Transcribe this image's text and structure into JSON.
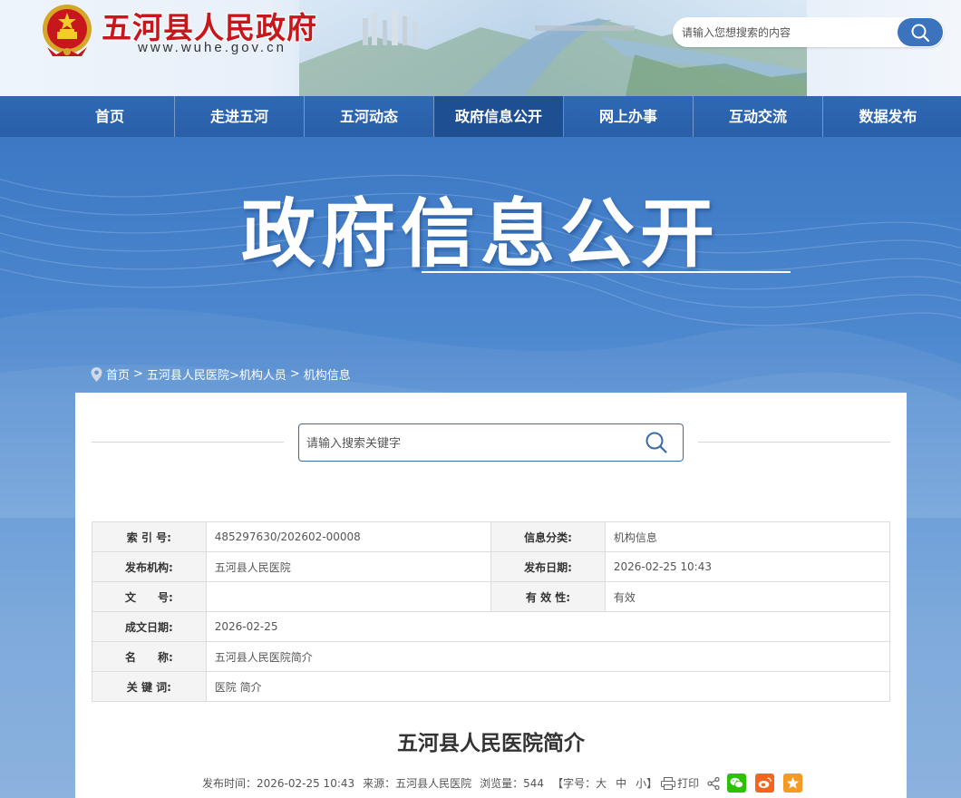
{
  "header": {
    "site_title": "五河县人民政府",
    "site_domain": "www.wuhe.gov.cn",
    "search_placeholder": "请输入您想搜索的内容"
  },
  "nav": {
    "items": [
      {
        "label": "首页",
        "active": false
      },
      {
        "label": "走进五河",
        "active": false
      },
      {
        "label": "五河动态",
        "active": false
      },
      {
        "label": "政府信息公开",
        "active": true
      },
      {
        "label": "网上办事",
        "active": false
      },
      {
        "label": "互动交流",
        "active": false
      },
      {
        "label": "数据发布",
        "active": false
      }
    ]
  },
  "banner": {
    "title": "政府信息公开"
  },
  "breadcrumb": {
    "home": "首页",
    "sep": ">",
    "crumb1": "五河县人民医院",
    "crumb2": ">机构人员",
    "crumb3": "机构信息"
  },
  "panel_search": {
    "placeholder": "请输入搜索关键字"
  },
  "info_table": {
    "index_label": "索 引 号:",
    "index_value": "485297630/202602-00008",
    "category_label": "信息分类:",
    "category_value": "机构信息",
    "publisher_label": "发布机构:",
    "publisher_value": "五河县人民医院",
    "publish_date_label": "发布日期:",
    "publish_date_value": "2026-02-25 10:43",
    "docno_label": "文　　号:",
    "docno_value": "",
    "validity_label": "有 效 性:",
    "validity_value": "有效",
    "created_label": "成文日期:",
    "created_value": "2026-02-25",
    "name_label": "名　　称:",
    "name_value": "五河县人民医院简介",
    "keywords_label": "关 键 词:",
    "keywords_value": "医院 简介"
  },
  "article": {
    "title": "五河县人民医院简介",
    "publish_time": "发布时间：2026-02-25 10:43",
    "source": "来源：五河县人民医院",
    "views": "浏览量：544",
    "font_size_prefix": "【字号：",
    "font_large": "大",
    "font_medium": "中",
    "font_small": "小",
    "font_size_suffix": "】",
    "print": "打印"
  },
  "colors": {
    "brand_red": "#c8161d",
    "nav_blue": "#2a5fa8",
    "nav_active": "#1f4f93",
    "wechat_green": "#2dc100",
    "weibo_orange": "#f4651f",
    "favorite_orange": "#f59a23"
  },
  "icons": [
    "national-emblem",
    "search-icon",
    "location-pin-icon",
    "print-icon",
    "share-icon",
    "wechat-icon",
    "weibo-icon",
    "star-icon"
  ]
}
